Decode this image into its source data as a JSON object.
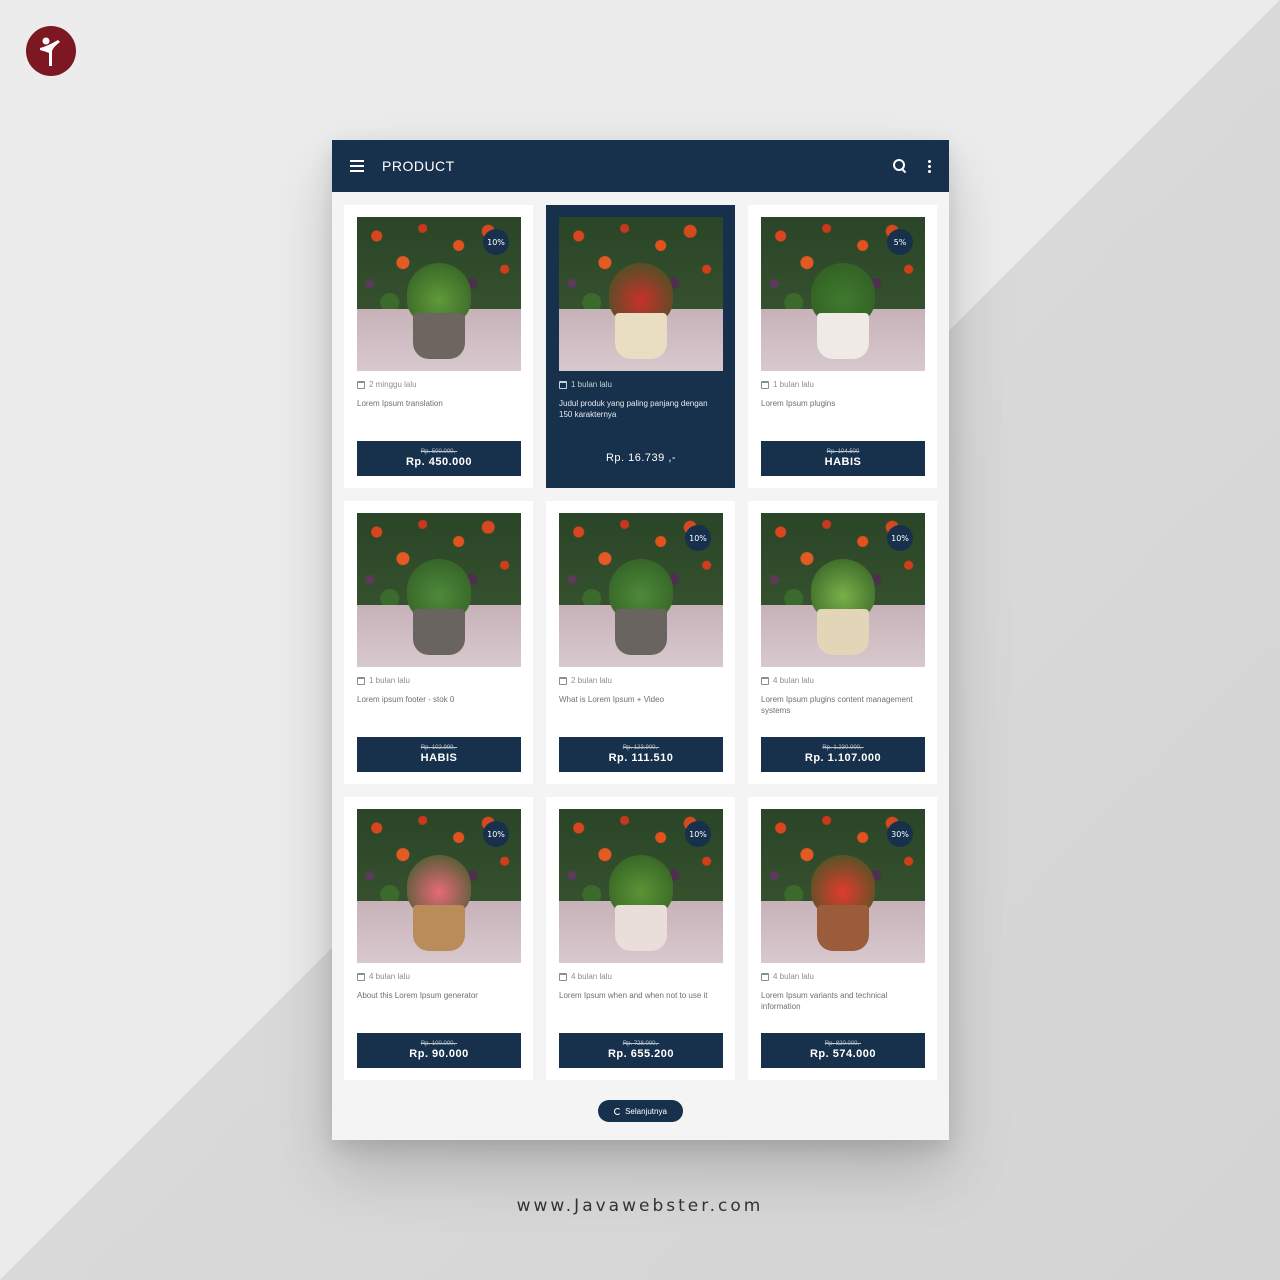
{
  "appbar": {
    "title": "PRODUCT"
  },
  "products": [
    {
      "date": "2 minggu lalu",
      "name": "Lorem Ipsum translation",
      "old_price": "Rp. 500.000,-",
      "price": "Rp. 450.000",
      "badge": "10%",
      "pot": "#6d6660",
      "leaf": "#5f9a3a",
      "active": false
    },
    {
      "date": "1 bulan lalu",
      "name": "Judul produk yang paling panjang dengan 150 karakternya",
      "old_price": "",
      "price": "Rp. 16.739 ,-",
      "badge": "",
      "pot": "#e9ddc2",
      "leaf": "#c9302c",
      "active": true
    },
    {
      "date": "1 bulan lalu",
      "name": "Lorem Ipsum plugins",
      "old_price": "Rp. 104.500",
      "price": "HABIS",
      "badge": "5%",
      "pot": "#efeae6",
      "leaf": "#3f7a2e",
      "active": false
    },
    {
      "date": "1 bulan lalu",
      "name": "Lorem ipsum footer - stok 0",
      "old_price": "Rp. 102.999,-",
      "price": "HABIS",
      "badge": "",
      "pot": "#6a6461",
      "leaf": "#4d8a3a",
      "active": false
    },
    {
      "date": "2 bulan lalu",
      "name": "What is Lorem Ipsum + Video",
      "old_price": "Rp. 123.900,-",
      "price": "Rp. 111.510",
      "badge": "10%",
      "pot": "#6a6461",
      "leaf": "#4d8a3a",
      "active": false
    },
    {
      "date": "4 bulan lalu",
      "name": "Lorem Ipsum plugins content management systems",
      "old_price": "Rp. 1.230.000,-",
      "price": "Rp. 1.107.000",
      "badge": "10%",
      "pot": "#e3d5b8",
      "leaf": "#79b04a",
      "active": false
    },
    {
      "date": "4 bulan lalu",
      "name": "About this Lorem Ipsum generator",
      "old_price": "Rp. 100.000,-",
      "price": "Rp. 90.000",
      "badge": "10%",
      "pot": "#b98c5a",
      "leaf": "#e86a7a",
      "active": false
    },
    {
      "date": "4 bulan lalu",
      "name": "Lorem Ipsum when and when not to use it",
      "old_price": "Rp. 728.000,-",
      "price": "Rp. 655.200",
      "badge": "10%",
      "pot": "#eadfd8",
      "leaf": "#5b9436",
      "active": false
    },
    {
      "date": "4 bulan lalu",
      "name": "Lorem Ipsum variants and technical information",
      "old_price": "Rp. 820.000,-",
      "price": "Rp. 574.000",
      "badge": "30%",
      "pot": "#9a5c3a",
      "leaf": "#e23b2e",
      "active": false
    }
  ],
  "load_more": {
    "label": "Selanjutnya"
  },
  "footer": {
    "url": "www.Javawebster.com"
  },
  "colors": {
    "primary": "#17304b",
    "logo": "#7d1722"
  }
}
